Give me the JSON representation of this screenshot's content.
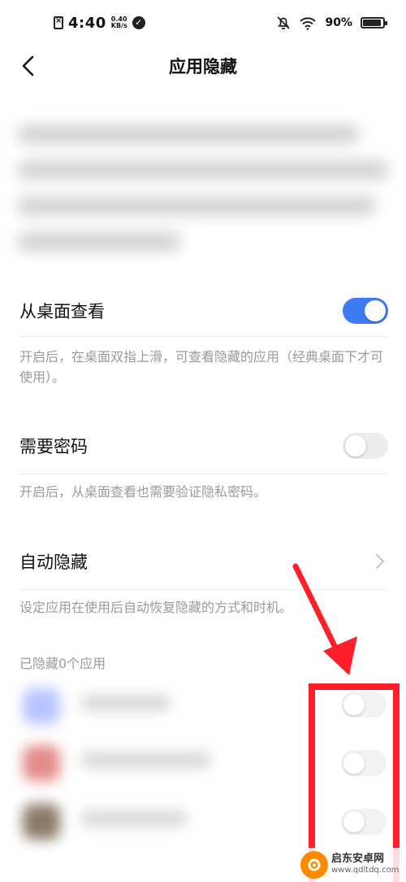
{
  "status_bar": {
    "time": "4:40",
    "speed_value": "0.40",
    "speed_unit": "KB/s",
    "battery": "90%",
    "battery_level": 0.9
  },
  "header": {
    "title": "应用隐藏"
  },
  "settings": {
    "desktop_view": {
      "label": "从桌面查看",
      "enabled": true,
      "description": "开启后，在桌面双指上滑，可查看隐藏的应用（经典桌面下才可使用）。"
    },
    "require_password": {
      "label": "需要密码",
      "enabled": false,
      "description": "开启后，从桌面查看也需要验证隐私密码。"
    },
    "auto_hide": {
      "label": "自动隐藏",
      "description": "设定应用在使用后自动恢复隐藏的方式和时机。"
    }
  },
  "hidden_apps": {
    "count_label": "已隐藏0个应用",
    "items": [
      {
        "icon_color": "#b7c3ff",
        "enabled": false
      },
      {
        "icon_color": "#e58a8a",
        "enabled": false
      },
      {
        "icon_color": "#8a7a68",
        "enabled": false
      }
    ]
  },
  "annotation": {
    "color": "#ff1f2a"
  },
  "watermark": {
    "name": "启东安卓网",
    "url": "www.qdltdq.com"
  },
  "colors": {
    "accent": "#3d7bf5",
    "secondary_text": "#9a9a9a"
  }
}
